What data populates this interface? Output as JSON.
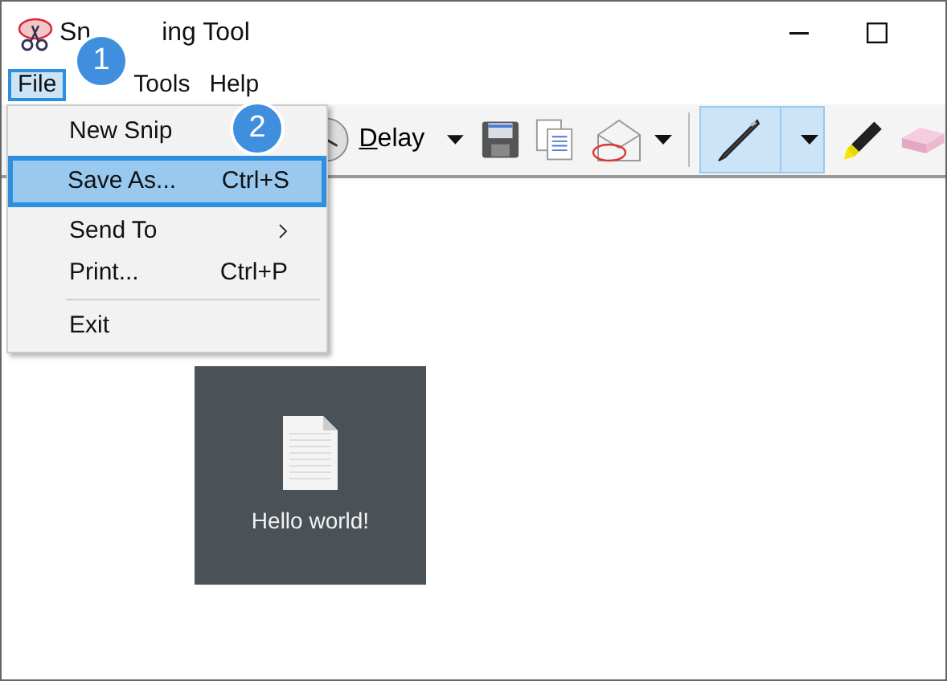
{
  "window": {
    "title_parts": [
      "Sn",
      "ing Tool"
    ]
  },
  "menu": [
    {
      "label": "File",
      "selected": true
    },
    {
      "label": "Tools",
      "selected": false
    },
    {
      "label": "Help",
      "selected": false
    }
  ],
  "file_menu": [
    {
      "kind": "item",
      "label": "New Snip",
      "selected": false
    },
    {
      "kind": "item",
      "label": "Save As...",
      "shortcut": "Ctrl+S",
      "selected": true
    },
    {
      "kind": "item",
      "label": "Send To",
      "submenu": true,
      "selected": false
    },
    {
      "kind": "item",
      "label": "Print...",
      "shortcut": "Ctrl+P",
      "selected": false
    },
    {
      "kind": "separator"
    },
    {
      "kind": "item",
      "label": "Exit",
      "selected": false
    }
  ],
  "callouts": [
    {
      "label": "1"
    },
    {
      "label": "2"
    }
  ],
  "toolbar": [
    {
      "kind": "delay",
      "label": "Delay"
    },
    {
      "kind": "save"
    },
    {
      "kind": "copy"
    },
    {
      "kind": "send"
    },
    {
      "kind": "separator"
    },
    {
      "kind": "pen",
      "selected": true
    },
    {
      "kind": "highlighter"
    },
    {
      "kind": "eraser"
    }
  ],
  "canvas": {
    "document": {
      "label": "Hello world!"
    }
  }
}
